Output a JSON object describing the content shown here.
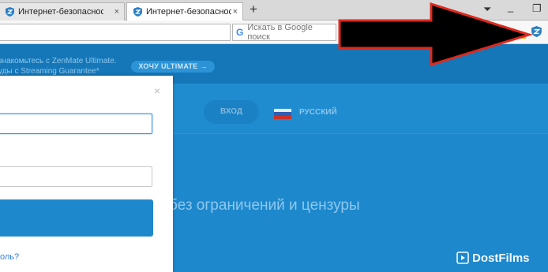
{
  "browser": {
    "tabs": [
      {
        "title": "Интернет-безопасность и"
      },
      {
        "title": "Интернет-безопасность и"
      }
    ],
    "new_tab_glyph": "+",
    "search_placeholder": "Искать в Google поиск",
    "window_controls": {
      "minimize": "_",
      "restore": "❐"
    }
  },
  "page": {
    "banner_text": "знакомьтесь с ZenMate Ultimate.\nуды с Streaming Guarantee*",
    "banner_button": "ХОЧУ ULTIMATE →",
    "nav": {
      "login": "ВХОД",
      "language": "РУССКИЙ"
    },
    "hero_text": "без ограничений и цензуры"
  },
  "modal": {
    "close_glyph": "×",
    "forgot_link": "оль?"
  },
  "watermark": "DostFilms",
  "icons": [
    "zenmate-shield-icon",
    "close-icon",
    "google-icon",
    "flag-ru-icon",
    "film-icon"
  ],
  "colors": {
    "page_blue": "#1e88cc",
    "banner_blue": "#1577b8",
    "arrow_red": "#e0281c"
  }
}
